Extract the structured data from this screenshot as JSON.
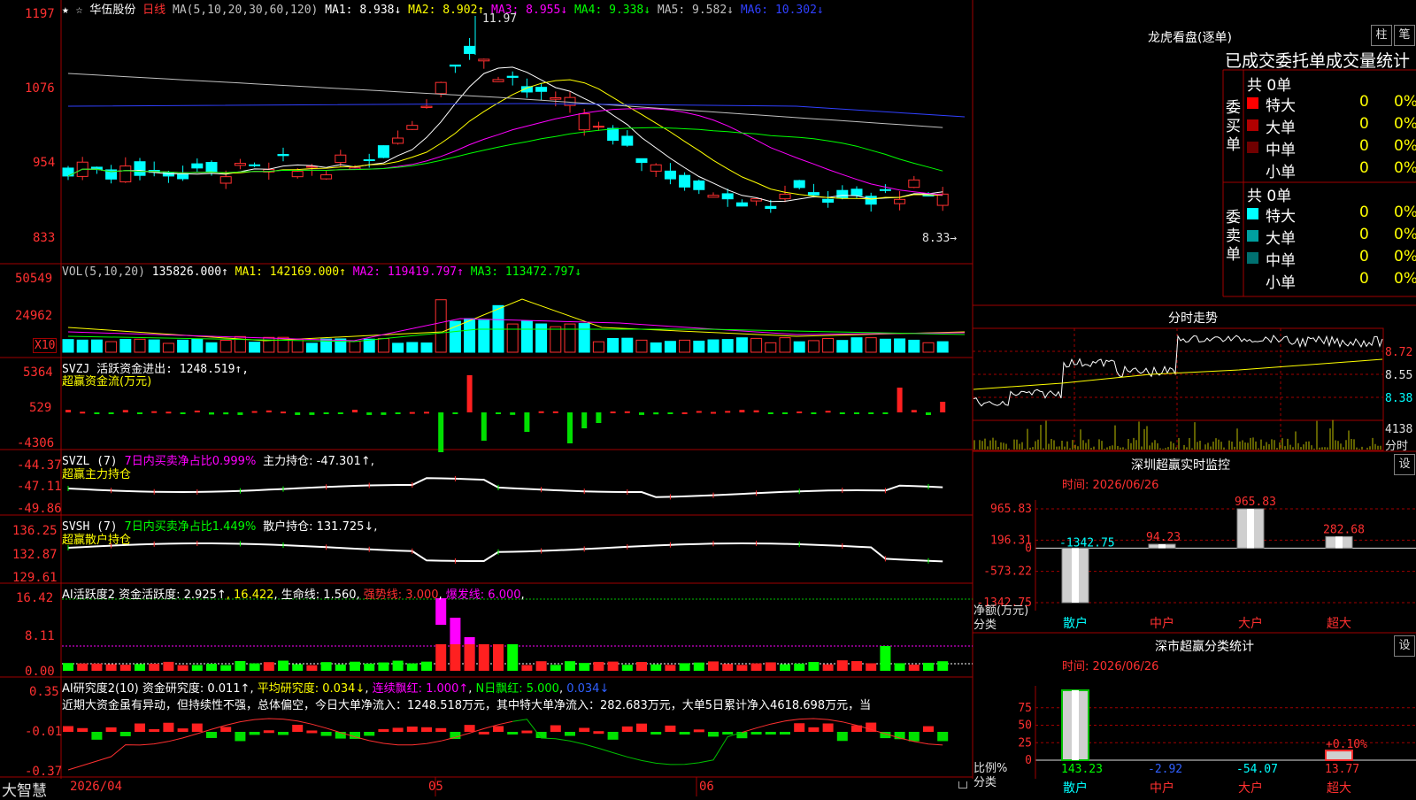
{
  "main_chart": {
    "star_symbols": "★ ☆",
    "stock_name": "华伍股份",
    "period": "日线",
    "ma_params": "MA(5,10,20,30,60,120)",
    "ma1": "MA1: 8.938↓",
    "ma2": "MA2: 8.902↑",
    "ma3": "MA3: 8.955↓",
    "ma4": "MA4: 9.338↓",
    "ma5": "MA5: 9.582↓",
    "ma6": "MA6: 10.302↓",
    "y_ticks": [
      "1197",
      "1076",
      "954",
      "833"
    ],
    "high_label": "11.97",
    "low_label": "8.33→"
  },
  "vol_panel": {
    "title": "VOL(5,10,20)",
    "value": "135826.000↑",
    "ma1": "MA1: 142169.000↑",
    "ma2": "MA2: 119419.797↑",
    "ma3": "MA3: 113472.797↓",
    "y_ticks": [
      "50549",
      "24962"
    ],
    "unit": "X10"
  },
  "svzj_panel": {
    "line1": "SVZJ  活跃资金进出: 1248.519↑,",
    "line2": "超赢资金流(万元)",
    "y_ticks": [
      "5364",
      "529",
      "-4306"
    ]
  },
  "svzl_panel": {
    "prefix": "SVZL (7)",
    "ratio": "7日内买卖净占比0.999%",
    "value": "主力持仓: -47.301↑,",
    "line2": "超赢主力持仓",
    "y_ticks": [
      "-44.37",
      "-47.11",
      "-49.86"
    ]
  },
  "svsh_panel": {
    "prefix": "SVSH (7)",
    "ratio": "7日内买卖净占比1.449%",
    "value": "散户持仓: 131.725↓,",
    "line2": "超赢散户持仓",
    "y_ticks": [
      "136.25",
      "132.87",
      "129.61"
    ]
  },
  "ai_active_panel": {
    "title": "AI活跃度2",
    "activity": "资金活跃度: 2.925↑",
    "v2": "16.422",
    "life": "生命线: 1.560",
    "strong": "强势线: 3.000",
    "burst": "爆发线: 6.000",
    "y_ticks": [
      "16.42",
      "8.11",
      "0.00"
    ]
  },
  "ai_research_panel": {
    "title": "AI研究度2(10)",
    "research": "资金研究度: 0.011↑",
    "avg": "平均研究度: 0.034↓",
    "consecutive": "连续飘红: 1.000↑",
    "nday": "N日飘红: 5.000",
    "last": "0.034↓",
    "comment": "近期大资金虽有异动，但持续性不强，总体偏空，今日大单净流入：1248.518万元，其中特大单净流入：282.683万元，大单5日累计净入4618.698万元，当",
    "y_ticks": [
      "0.35",
      "-0.01",
      "-0.37"
    ]
  },
  "bottom_bar": {
    "brand": "大智慧",
    "dates": [
      "2026/04",
      "05",
      "06"
    ]
  },
  "dragon_panel": {
    "title": "龙虎看盘(逐单)",
    "btn_bar": "柱",
    "btn_pen": "笔",
    "tabs_text": "已成交委托单成交量统计",
    "buy_label": "委买单",
    "sell_label": "委卖单",
    "buy_total": "共 0单",
    "sell_total": "共 0单",
    "buy_rows": [
      {
        "label": "特大",
        "count": "0",
        "pct": "0%",
        "color": "#ff0000"
      },
      {
        "label": "大单",
        "count": "0",
        "pct": "0%",
        "color": "#b00000"
      },
      {
        "label": "中单",
        "count": "0",
        "pct": "0%",
        "color": "#700000"
      },
      {
        "label": "小单",
        "count": "0",
        "pct": "0%",
        "color": ""
      }
    ],
    "sell_rows": [
      {
        "label": "特大",
        "count": "0",
        "pct": "0%",
        "color": "#00ffff"
      },
      {
        "label": "大单",
        "count": "0",
        "pct": "0%",
        "color": "#00a0a0"
      },
      {
        "label": "中单",
        "count": "0",
        "pct": "0%",
        "color": "#007070"
      },
      {
        "label": "小单",
        "count": "0",
        "pct": "0%",
        "color": ""
      }
    ]
  },
  "intraday_panel": {
    "title": "分时走势",
    "prices": [
      "8.72",
      "8.55",
      "8.38"
    ],
    "volume": "4138",
    "volume_label": "分时"
  },
  "sz_monitor_panel": {
    "title": "深圳超赢实时监控",
    "settings_btn": "设",
    "time": "时间: 2026/06/26",
    "y_ticks": [
      "965.83",
      "196.31",
      "0",
      "-573.22",
      "-1342.75"
    ],
    "axis_label": "净额(万元)",
    "category_label": "分类",
    "categories": [
      "散户",
      "中户",
      "大户",
      "超大"
    ],
    "value_labels": [
      "-1342.75",
      "94.23",
      "965.83",
      "282.68"
    ]
  },
  "sz_classify_panel": {
    "title": "深市超赢分类统计",
    "settings_btn": "设",
    "time": "时间: 2026/06/26",
    "y_ticks": [
      "75",
      "50",
      "25",
      "0"
    ],
    "axis_label": "比例%",
    "category_label": "分类",
    "categories": [
      "散户",
      "中户",
      "大户",
      "超大"
    ],
    "value_labels": [
      "143.23",
      "-2.92",
      "-54.07",
      "13.77"
    ],
    "note": "+0.10%"
  },
  "chart_data": {
    "type": "bar",
    "title": "深圳超赢实时监控",
    "ylabel": "净额(万元)",
    "categories": [
      "散户",
      "中户",
      "大户",
      "超大"
    ],
    "values": [
      -1342.75,
      94.23,
      965.83,
      282.68
    ],
    "ylim": [
      -1342.75,
      965.83
    ]
  }
}
